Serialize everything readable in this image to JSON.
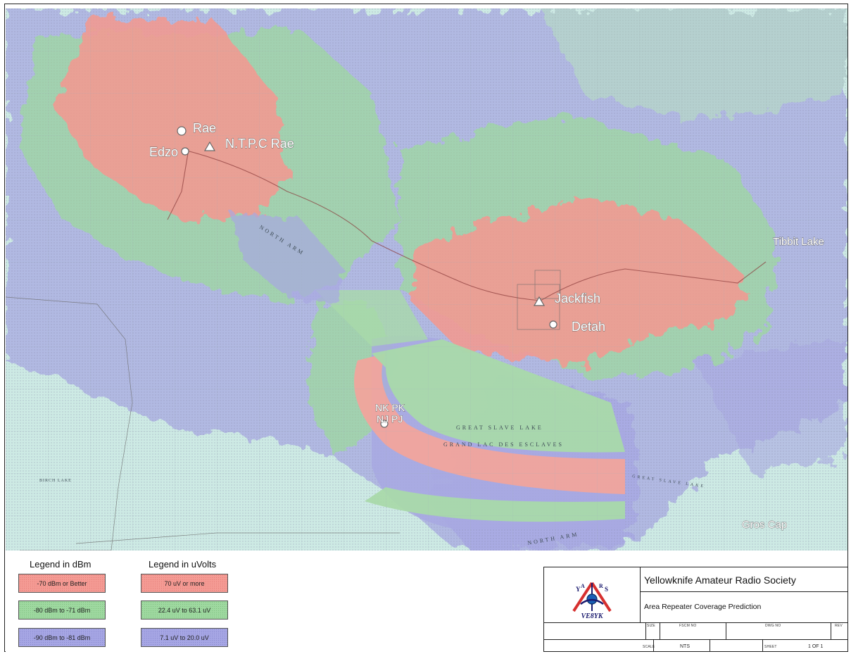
{
  "map": {
    "site_labels": [
      "Rae",
      "Edzo",
      "N.T.P.C Rae",
      "Jackfish",
      "Detah",
      "NK PK",
      "NJ PJ",
      "Tibbit Lake",
      "Gros Cap"
    ],
    "water_labels": [
      "GREAT SLAVE LAKE",
      "GRAND LAC DES ESCLAVES",
      "NORTH ARM",
      "GREAT SLAVE LAKE",
      "NORTH ARM",
      "BIRCH LAKE"
    ]
  },
  "legend": {
    "dbm_title": "Legend in dBm",
    "uvolt_title": "Legend in uVolts",
    "dbm_items": [
      "-70 dBm or Better",
      "-80 dBm to -71 dBm",
      "-90 dBm to -81 dBm"
    ],
    "uvolt_items": [
      "70 uV or more",
      "22.4 uV to 63.1 uV",
      "7.1 uV to 20.0 uV"
    ],
    "colors": {
      "strong": "#f49b94",
      "medium": "#9ed8a0",
      "weak": "#a6a6e4"
    }
  },
  "title_block": {
    "callsign": "VE8YK",
    "logo_letters": [
      "Y",
      "A",
      "R",
      "S"
    ],
    "organization": "Yellowknife Amateur Radio Society",
    "title": "Area Repeater Coverage Prediction",
    "size_label": "SIZE",
    "fscm_label": "FSCM NO",
    "dwg_label": "DWG NO",
    "rev_label": "REV",
    "scale_label": "SCALE",
    "scale_value": "NTS",
    "sheet_label": "SHEET",
    "sheet_value": "1 OF 1"
  }
}
